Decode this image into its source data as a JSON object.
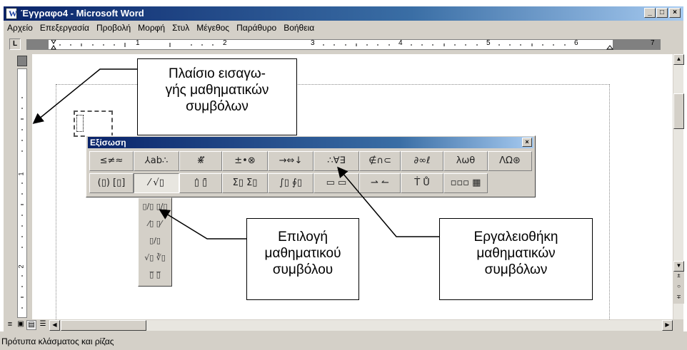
{
  "window": {
    "title": "Έγγραφο4 - Microsoft Word",
    "buttons": [
      "_",
      "□",
      "×"
    ]
  },
  "menu": [
    "Αρχείο",
    "Επεξεργασία",
    "Προβολή",
    "Μορφή",
    "Στυλ",
    "Μέγεθος",
    "Παράθυρο",
    "Βοήθεια"
  ],
  "ruler": {
    "tab_selector": "L",
    "numbers": [
      "1",
      "2",
      "3",
      "4",
      "5",
      "6",
      "7"
    ],
    "vnumbers": [
      "1",
      "2"
    ]
  },
  "equation_toolbar": {
    "title": "Εξίσωση",
    "close": "×",
    "row1": [
      "≤≠≈",
      "⅄ab∴",
      "⋇⃗⃖⃡",
      "±•⊗",
      "→⇔↓",
      "∴∀∃",
      "∉∩⊂",
      "∂∞ℓ",
      "λωθ",
      "ΛΩ⊛"
    ],
    "row2": [
      "(▯) [▯]",
      "⁄ √▯",
      "▯̇ ▯̄",
      "Σ▯ Σ▯",
      "∫▯ ∮▯",
      "▭ ▭",
      "⇀ ↼",
      "Ṫ Ů",
      "▫▫▫ ▦"
    ]
  },
  "palette": {
    "items": [
      "▯/▯  ▯/▯",
      "⁄▯  ▯⁄",
      "▯/▯",
      "√▯  ∛▯",
      "▯̅  ▯̅"
    ]
  },
  "callouts": {
    "frame": "Πλαίσιο εισαγω-\nγής μαθηματικών\nσυμβόλων",
    "symbol": "Επιλογή\nμαθηματικού\nσυμβόλου",
    "toolbox": "Εργαλειοθήκη\nμαθηματικών\nσυμβόλων"
  },
  "status": "Πρότυπα κλάσματος και ρίζας"
}
